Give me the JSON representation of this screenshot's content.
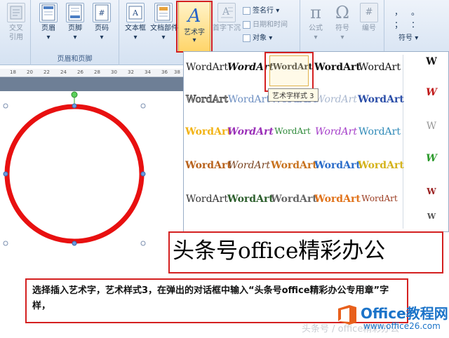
{
  "ribbon": {
    "group_crossref": {
      "label_line1": "交叉",
      "label_line2": "引用"
    },
    "group_header_footer": {
      "header": "页眉",
      "footer": "页脚",
      "page_number": "页码",
      "group_label": "页眉和页脚"
    },
    "group_text": {
      "text_box": "文本框",
      "doc_parts": "文档部件",
      "wordart": "艺术字",
      "drop_cap": "首字下沉",
      "signature_line": "签名行",
      "date_time": "日期和时间",
      "object": "对象"
    },
    "group_symbols": {
      "formula": "公式",
      "symbol": "符号",
      "numbering": "编号",
      "formula_glyph": "π",
      "symbol_glyph": "Ω",
      "numbering_glyph": "#",
      "special_symbols_label": "符号",
      "special_row1": [
        "，",
        "。"
      ],
      "special_row2": [
        "；",
        "："
      ]
    }
  },
  "ruler": {
    "ticks": [
      "18",
      "20",
      "22",
      "24",
      "26",
      "28",
      "30",
      "32",
      "34",
      "36",
      "38",
      "40"
    ]
  },
  "gallery": {
    "items": [
      "WordArt",
      "WordArt",
      "WordArt",
      "WordArt",
      "WordArt",
      "WordArt",
      "WordArt",
      "WordArt",
      "WordArt",
      "WordArt",
      "WordArt",
      "WordArt",
      "WordArt",
      "WordArt",
      "WordArt",
      "WordArt",
      "WordArt",
      "WordArt",
      "WordArt",
      "WordArt",
      "WordArt",
      "WordArt",
      "WordArt",
      "WordArt",
      "WordArt"
    ],
    "side_items": [
      "W",
      "W",
      "W",
      "W",
      "W",
      "W"
    ],
    "tooltip": "艺术字样式 3"
  },
  "document": {
    "inserted_text": "头条号office精彩办公"
  },
  "caption": {
    "text": "选择插入艺术字，艺术样式3，在弹出的对话框中输入“头条号office精彩办公专用章”字样，"
  },
  "watermark": {
    "text": "头条号 / office精彩办公"
  },
  "logo": {
    "brand": "Office教程网",
    "url": "www.office26.com"
  },
  "colors": {
    "highlight": "#d42020",
    "circle": "#e81010",
    "selection": "#ffd56a"
  }
}
